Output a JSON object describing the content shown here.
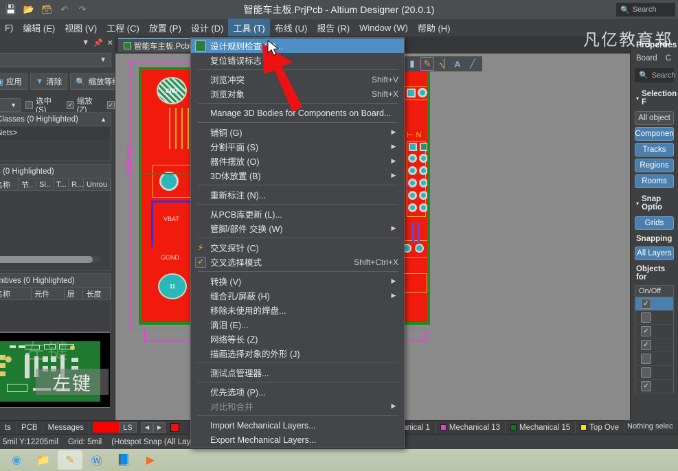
{
  "titlebar": {
    "title": "智能车主板.PrjPcb - Altium Designer (20.0.1)",
    "icons": [
      {
        "name": "save-icon",
        "glyph": "💾"
      },
      {
        "name": "open-folder-icon",
        "glyph": "📂"
      },
      {
        "name": "save-as-icon",
        "glyph": "🗂"
      },
      {
        "name": "undo-icon",
        "glyph": "↶"
      },
      {
        "name": "redo-icon",
        "glyph": "↷"
      }
    ],
    "search_placeholder": "Search",
    "search_icon": "search-icon"
  },
  "menubar": {
    "items": [
      {
        "label": "F)",
        "active": false
      },
      {
        "label": "编辑 (E)",
        "active": false
      },
      {
        "label": "视图 (V)",
        "active": false
      },
      {
        "label": "工程 (C)",
        "active": false
      },
      {
        "label": "放置 (P)",
        "active": false
      },
      {
        "label": "设计 (D)",
        "active": false
      },
      {
        "label": "工具 (T)",
        "active": true
      },
      {
        "label": "布线 (U)",
        "active": false
      },
      {
        "label": "报告 (R)",
        "active": false
      },
      {
        "label": "Window (W)",
        "active": false
      },
      {
        "label": "帮助 (H)",
        "active": false
      }
    ]
  },
  "doc_tab": {
    "label": "智能车主板.PcbDoc",
    "icon": "pcb-document-icon"
  },
  "watermark": {
    "top_right": "凡亿教育郑",
    "preview_overlay": "左键",
    "preview_ghost": "左键"
  },
  "tools_menu": {
    "items": [
      {
        "label": "设计规则检查 (D)...",
        "accel": "",
        "icon": "drc-icon",
        "selected": true,
        "submenu": false,
        "disabled": false
      },
      {
        "label": "复位错误标志 (M)",
        "accel": "",
        "icon": "",
        "selected": false,
        "submenu": false,
        "disabled": false
      },
      {
        "sep": true
      },
      {
        "label": "浏览冲突",
        "accel": "Shift+V",
        "icon": "",
        "selected": false,
        "submenu": false,
        "disabled": false
      },
      {
        "label": "浏览对象",
        "accel": "Shift+X",
        "icon": "",
        "selected": false,
        "submenu": false,
        "disabled": false
      },
      {
        "sep": true
      },
      {
        "label": "Manage 3D Bodies for Components on Board...",
        "accel": "",
        "icon": "",
        "selected": false,
        "submenu": false,
        "disabled": false
      },
      {
        "sep": true
      },
      {
        "label": "铺铜 (G)",
        "accel": "",
        "icon": "",
        "selected": false,
        "submenu": true,
        "disabled": false
      },
      {
        "label": "分割平面 (S)",
        "accel": "",
        "icon": "",
        "selected": false,
        "submenu": true,
        "disabled": false
      },
      {
        "label": "器件摆放 (O)",
        "accel": "",
        "icon": "",
        "selected": false,
        "submenu": true,
        "disabled": false
      },
      {
        "label": "3D体放置 (B)",
        "accel": "",
        "icon": "",
        "selected": false,
        "submenu": true,
        "disabled": false
      },
      {
        "sep": true
      },
      {
        "label": "重新标注 (N)...",
        "accel": "",
        "icon": "",
        "selected": false,
        "submenu": false,
        "disabled": false
      },
      {
        "sep": true
      },
      {
        "label": "从PCB库更新 (L)...",
        "accel": "",
        "icon": "",
        "selected": false,
        "submenu": false,
        "disabled": false
      },
      {
        "label": "管脚/部件 交换 (W)",
        "accel": "",
        "icon": "",
        "selected": false,
        "submenu": true,
        "disabled": false
      },
      {
        "sep": true
      },
      {
        "label": "交叉探针 (C)",
        "accel": "",
        "icon": "cross-probe-icon",
        "selected": false,
        "submenu": false,
        "disabled": false
      },
      {
        "label": "交叉选择模式",
        "accel": "Shift+Ctrl+X",
        "icon": "cross-select-icon",
        "selected": false,
        "submenu": false,
        "disabled": false
      },
      {
        "sep": true
      },
      {
        "label": "转换 (V)",
        "accel": "",
        "icon": "",
        "selected": false,
        "submenu": true,
        "disabled": false
      },
      {
        "label": "缝合孔/屏蔽 (H)",
        "accel": "",
        "icon": "",
        "selected": false,
        "submenu": true,
        "disabled": false
      },
      {
        "label": "移除未使用的焊盘...",
        "accel": "",
        "icon": "",
        "selected": false,
        "submenu": false,
        "disabled": false
      },
      {
        "label": "滴泪 (E)...",
        "accel": "",
        "icon": "",
        "selected": false,
        "submenu": false,
        "disabled": false
      },
      {
        "label": "网络等长 (Z)",
        "accel": "",
        "icon": "",
        "selected": false,
        "submenu": false,
        "disabled": false
      },
      {
        "label": "描画选择对象的外形 (J)",
        "accel": "",
        "icon": "",
        "selected": false,
        "submenu": false,
        "disabled": false
      },
      {
        "sep": true
      },
      {
        "label": "测试点管理器...",
        "accel": "",
        "icon": "",
        "selected": false,
        "submenu": false,
        "disabled": false
      },
      {
        "sep": true
      },
      {
        "label": "优先选项 (P)...",
        "accel": "",
        "icon": "",
        "selected": false,
        "submenu": false,
        "disabled": false
      },
      {
        "label": "对比和合并",
        "accel": "",
        "icon": "",
        "selected": false,
        "submenu": true,
        "disabled": true
      },
      {
        "sep": true
      },
      {
        "label": "Import Mechanical Layers...",
        "accel": "",
        "icon": "",
        "selected": false,
        "submenu": false,
        "disabled": false
      },
      {
        "label": "Export Mechanical Layers...",
        "accel": "",
        "icon": "",
        "selected": false,
        "submenu": false,
        "disabled": false
      }
    ]
  },
  "left_panel": {
    "header_buttons": [
      "chevron-down-icon",
      "pin-icon",
      "close-icon"
    ],
    "combo_value": "",
    "buttons": [
      {
        "label": "应用",
        "icon": "apply-icon"
      },
      {
        "label": "清除",
        "icon": "clear-icon"
      },
      {
        "label": "缩放等级...",
        "icon": "magnifier-icon"
      }
    ],
    "checkboxes": [
      {
        "label": "选中 (S)",
        "checked": false
      },
      {
        "label": "缩放 (Z)",
        "checked": true
      },
      {
        "label": "",
        "checked": true
      }
    ],
    "sections": [
      {
        "title": "Classes (0 Highlighted)",
        "body": "Nets>"
      },
      {
        "title": "s (0 Highlighted)",
        "columns": [
          "名称",
          "节..",
          "Si..",
          "T...",
          "R...",
          "Unrou"
        ]
      },
      {
        "title": "mitives (0 Highlighted)",
        "columns": [
          "名称",
          "元件",
          "层",
          "长度"
        ]
      }
    ]
  },
  "right_panel": {
    "title": "Properties",
    "tabs": [
      "Board",
      "C"
    ],
    "search_placeholder": "Search",
    "search_icon": "search-icon",
    "sections": [
      {
        "title": "Selection F",
        "buttons": [
          {
            "label": "All object",
            "on": false
          },
          {
            "label": "Componen",
            "on": true
          },
          {
            "label": "Tracks",
            "on": true
          },
          {
            "label": "Regions",
            "on": true
          },
          {
            "label": "Rooms",
            "on": true
          }
        ]
      },
      {
        "title": "Snap Optio",
        "buttons": [
          {
            "label": "Grids",
            "on": true
          }
        ],
        "sub_label": "Snapping",
        "sub_buttons": [
          {
            "label": "All Layers",
            "on": true
          }
        ]
      }
    ],
    "objects_label": "Objects for ",
    "table_header": "On/Off",
    "rows": [
      {
        "checked": true,
        "selected": true
      },
      {
        "checked": false,
        "selected": false
      },
      {
        "checked": true,
        "selected": false
      },
      {
        "checked": true,
        "selected": false
      },
      {
        "checked": false,
        "selected": false
      },
      {
        "checked": false,
        "selected": false
      },
      {
        "checked": true,
        "selected": false
      }
    ],
    "status": "Nothing selec"
  },
  "layer_bar": {
    "left_tabs": [
      "ts",
      "PCB",
      "Messages"
    ],
    "ls_label": "LS",
    "ls_color": "#ff0000",
    "nav_prev": "◀",
    "nav_next": "▶",
    "active_color": "#ee1111",
    "layers": [
      {
        "label": "Mechanical 1",
        "color": "#3a3c3e"
      },
      {
        "label": "Mechanical 13",
        "color": "#ff2ee6"
      },
      {
        "label": "Mechanical 15",
        "color": "#0a7a12"
      },
      {
        "label": "Top Ove",
        "color": "#ffe400"
      }
    ]
  },
  "status_bar": {
    "coords": "5mil Y:12205mil",
    "grid": "Grid: 5mil",
    "snap": "(Hotspot Snap (All Layers"
  },
  "taskbar": {
    "items": [
      {
        "name": "chrome-icon",
        "glyph": "◉",
        "color": "#4aa3df",
        "active": false
      },
      {
        "name": "file-explorer-icon",
        "glyph": "📁",
        "color": "#e8c35a",
        "active": false
      },
      {
        "name": "app-yellow-icon",
        "glyph": "✎",
        "color": "#d8a13a",
        "active": true
      },
      {
        "name": "wps-icon",
        "glyph": "Ⓦ",
        "color": "#2b7fd4",
        "active": false
      },
      {
        "name": "notes-icon",
        "glyph": "📘",
        "color": "#5ba7d8",
        "active": false
      },
      {
        "name": "player-icon",
        "glyph": "▶",
        "color": "#f07020",
        "active": false
      }
    ]
  },
  "canvas": {
    "dimension_label": "65.00mm",
    "net_labels": [
      "VBAT",
      "GGND"
    ],
    "via_label": "11",
    "gnd_label": "GND",
    "board_color": "#f01b0c",
    "outline_color": "#1f8a20",
    "trace_color": "#3b2fd6",
    "pad_color": "#2bb7b7"
  },
  "toolbar2": {
    "icons": [
      {
        "name": "place-polygon-icon",
        "glyph": "⬛"
      },
      {
        "name": "place-fill-icon",
        "glyph": "✏"
      },
      {
        "name": "place-component-icon",
        "glyph": "⌗"
      },
      {
        "name": "place-text-icon",
        "glyph": "A"
      },
      {
        "name": "place-line-icon",
        "glyph": "╱"
      }
    ]
  }
}
